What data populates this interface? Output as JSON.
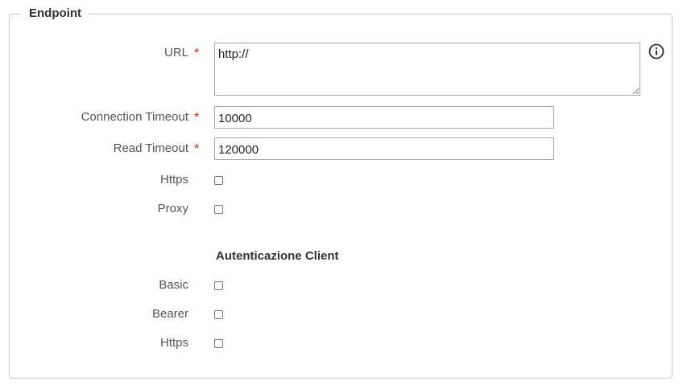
{
  "fieldset": {
    "legend": "Endpoint"
  },
  "required_mark": "*",
  "url": {
    "label": "URL",
    "value": "http://",
    "info_icon": "info-circle-icon"
  },
  "connection_timeout": {
    "label": "Connection Timeout",
    "value": "10000"
  },
  "read_timeout": {
    "label": "Read Timeout",
    "value": "120000"
  },
  "https": {
    "label": "Https",
    "checked": false
  },
  "proxy": {
    "label": "Proxy",
    "checked": false
  },
  "client_auth": {
    "title": "Autenticazione Client",
    "basic": {
      "label": "Basic",
      "checked": false
    },
    "bearer": {
      "label": "Bearer",
      "checked": false
    },
    "https": {
      "label": "Https",
      "checked": false
    }
  },
  "colors": {
    "required": "#e8262a",
    "border": "#c8c8c8",
    "label": "#555555"
  }
}
